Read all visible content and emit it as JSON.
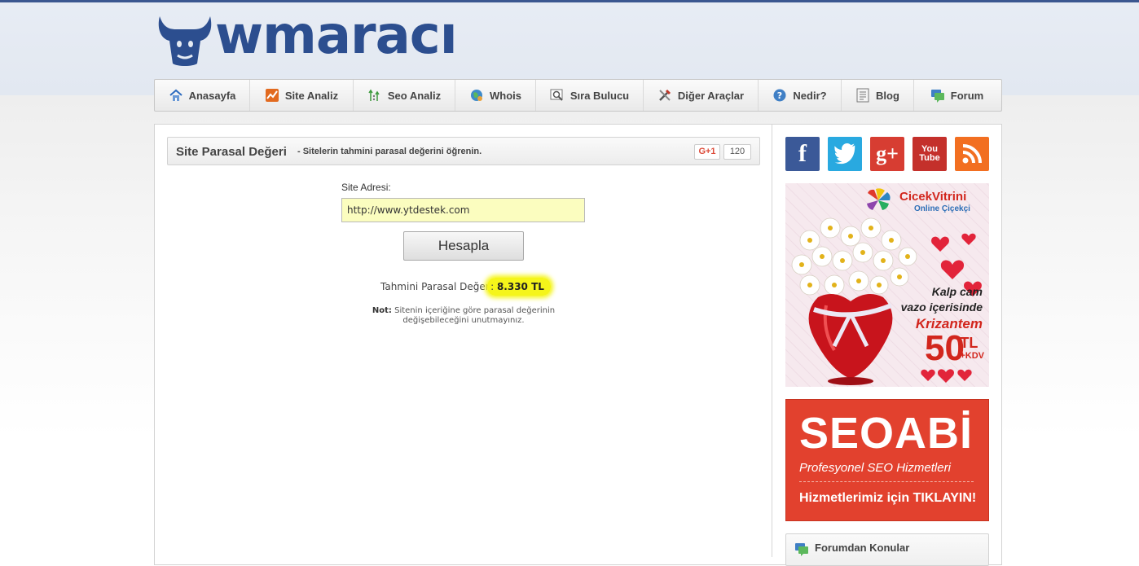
{
  "logo": {
    "text": "wmaracı"
  },
  "nav": {
    "items": [
      {
        "label": "Anasayfa",
        "icon": "home-icon"
      },
      {
        "label": "Site Analiz",
        "icon": "chart-icon"
      },
      {
        "label": "Seo Analiz",
        "icon": "seo-icon"
      },
      {
        "label": "Whois",
        "icon": "globe-icon"
      },
      {
        "label": "Sıra Bulucu",
        "icon": "magnifier-icon"
      },
      {
        "label": "Diğer Araçlar",
        "icon": "tools-icon"
      },
      {
        "label": "Nedir?",
        "icon": "question-icon"
      },
      {
        "label": "Blog",
        "icon": "document-icon"
      },
      {
        "label": "Forum",
        "icon": "chat-icon"
      }
    ]
  },
  "page": {
    "title": "Site Parasal Değeri",
    "subtitle": "- Sitelerin tahmini parasal değerini öğrenin.",
    "gplus_label": "G+1",
    "gplus_count": "120"
  },
  "form": {
    "site_label": "Site Adresi:",
    "site_value": "http://www.ytdestek.com",
    "button_label": "Hesapla"
  },
  "result": {
    "label": "Tahmini Parasal Değeri",
    "colon": ":",
    "value": "8.330 TL",
    "note_label": "Not:",
    "note_text": "Sitenin içeriğine göre parasal değerinin değişebileceğini unutmayınız."
  },
  "sidebar": {
    "social": [
      {
        "name": "facebook",
        "glyph": "f",
        "color": "#3b5998"
      },
      {
        "name": "twitter",
        "glyph": "t",
        "color": "#29a9e0"
      },
      {
        "name": "googleplus",
        "glyph": "g+",
        "color": "#d73d32"
      },
      {
        "name": "youtube",
        "glyph": "You Tube",
        "color": "#c4302b"
      },
      {
        "name": "rss",
        "glyph": "rss",
        "color": "#f26f21"
      }
    ],
    "ad1": {
      "brand": "CicekVitrini",
      "brand_sub": "Online Çiçekçi",
      "line1": "Kalp cam",
      "line2": "vazo içerisinde",
      "product": "Krizantem",
      "price": "50",
      "currency": "TL",
      "tax": "+KDV"
    },
    "ad2": {
      "title": "SEOABİ",
      "tagline": "Profesyonel SEO Hizmetleri",
      "cta": "Hizmetlerimiz için TIKLAYIN!"
    },
    "forum_title": "Forumdan Konular"
  }
}
